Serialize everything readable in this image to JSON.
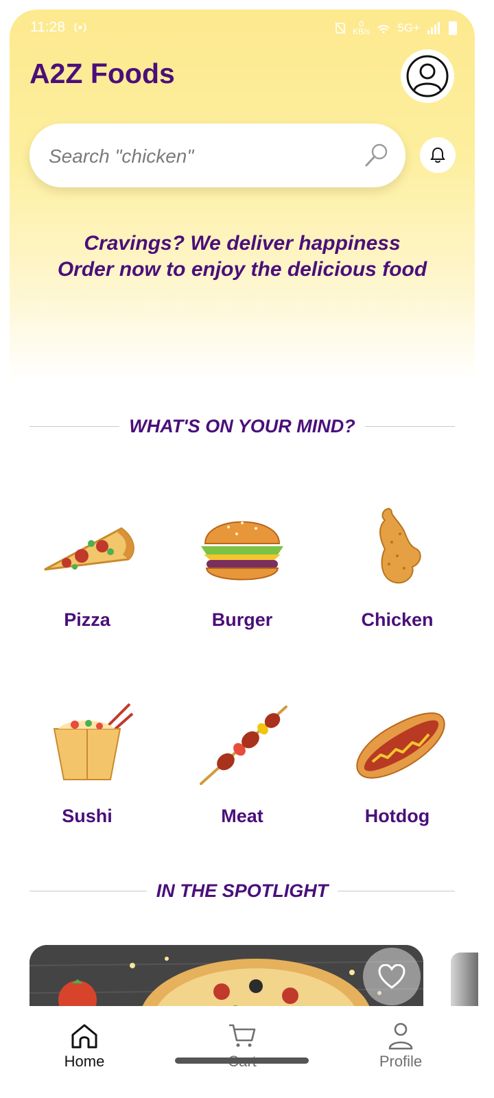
{
  "status_bar": {
    "time": "11:28",
    "net_speed_value": "0",
    "net_speed_unit": "KB/s",
    "network": "5G+"
  },
  "app": {
    "title": "A2Z Foods"
  },
  "search": {
    "placeholder": "Search \"chicken\""
  },
  "tagline": {
    "line1": "Cravings? We deliver happiness",
    "line2": "Order now to enjoy the delicious food"
  },
  "sections": {
    "mind_title": "WHAT'S ON YOUR MIND?",
    "spotlight_title": "IN THE SPOTLIGHT"
  },
  "categories": [
    {
      "label": "Pizza",
      "icon": "pizza-icon"
    },
    {
      "label": "Burger",
      "icon": "burger-icon"
    },
    {
      "label": "Chicken",
      "icon": "chicken-icon"
    },
    {
      "label": "Sushi",
      "icon": "noodle-box-icon"
    },
    {
      "label": "Meat",
      "icon": "skewer-icon"
    },
    {
      "label": "Hotdog",
      "icon": "hotdog-icon"
    }
  ],
  "bottom_nav": {
    "items": [
      {
        "label": "Home",
        "icon": "home-icon",
        "active": true
      },
      {
        "label": "Cart",
        "icon": "cart-icon",
        "active": false
      },
      {
        "label": "Profile",
        "icon": "profile-icon",
        "active": false
      }
    ]
  },
  "colors": {
    "brand_purple": "#4a0f7a",
    "header_yellow": "#fde98e"
  }
}
